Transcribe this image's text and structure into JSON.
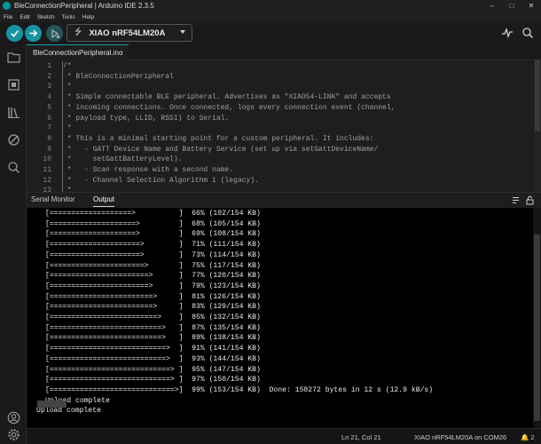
{
  "window": {
    "title": "BleConnectionPeripheral | Arduino IDE 2.3.5",
    "controls": [
      "–",
      "□",
      "✕"
    ]
  },
  "menu": [
    "File",
    "Edit",
    "Sketch",
    "Tools",
    "Help"
  ],
  "toolbar": {
    "board": "XIAO nRF54LM20A"
  },
  "tab": {
    "label": "BleConnectionPeripheral.ino"
  },
  "editor": {
    "lines": [
      {
        "n": "1",
        "text": "/*"
      },
      {
        "n": "2",
        "text": " * BleConnectionPeripheral"
      },
      {
        "n": "3",
        "text": " *"
      },
      {
        "n": "4",
        "text": " * Simple connectable BLE peripheral. Advertises as \"XIAO54-LINK\" and accepts"
      },
      {
        "n": "5",
        "text": " * incoming connections. Once connected, logs every connection event (channel,"
      },
      {
        "n": "6",
        "text": " * payload type, LLID, RSSI) to Serial."
      },
      {
        "n": "7",
        "text": " *"
      },
      {
        "n": "8",
        "text": " * This is a minimal starting point for a custom peripheral. It includes:"
      },
      {
        "n": "9",
        "text": " *   - GATT Device Name and Battery Service (set up via setGattDeviceName/"
      },
      {
        "n": "10",
        "text": " *     setGattBatteryLevel)."
      },
      {
        "n": "11",
        "text": " *   - Scan response with a second name."
      },
      {
        "n": "12",
        "text": " *   - Channel Selection Algorithm 1 (legacy)."
      },
      {
        "n": "13",
        "text": " *"
      }
    ]
  },
  "panel": {
    "tabs": [
      "Serial Monitor",
      "Output"
    ],
    "active_tab": "Output",
    "output_lines": [
      "[===================>          ]  66% (102/154 KB)",
      "[====================>         ]  68% (105/154 KB)",
      "[====================>         ]  69% (108/154 KB)",
      "[=====================>        ]  71% (111/154 KB)",
      "[=====================>        ]  73% (114/154 KB)",
      "[======================>       ]  75% (117/154 KB)",
      "[=======================>      ]  77% (120/154 KB)",
      "[=======================>      ]  79% (123/154 KB)",
      "[========================>     ]  81% (126/154 KB)",
      "[========================>     ]  83% (129/154 KB)",
      "[=========================>    ]  85% (132/154 KB)",
      "[==========================>   ]  87% (135/154 KB)",
      "[==========================>   ]  89% (138/154 KB)",
      "[===========================>  ]  91% (141/154 KB)",
      "[===========================>  ]  93% (144/154 KB)",
      "[============================> ]  95% (147/154 KB)",
      "[============================> ]  97% (150/154 KB)",
      "[=============================>]  99% (153/154 KB)  Done: 158272 bytes in 12 s (12.9 kB/s)",
      "Upload complete"
    ],
    "final_line": "Upload complete"
  },
  "status": {
    "position": "Ln 21, Col 21",
    "board_port": "XIAO nRF54LM20A on COM26",
    "notifications": "🔔 2"
  },
  "colors": {
    "accent": "#1893a1",
    "background": "#1e1e1e",
    "output_bg": "#000000"
  }
}
